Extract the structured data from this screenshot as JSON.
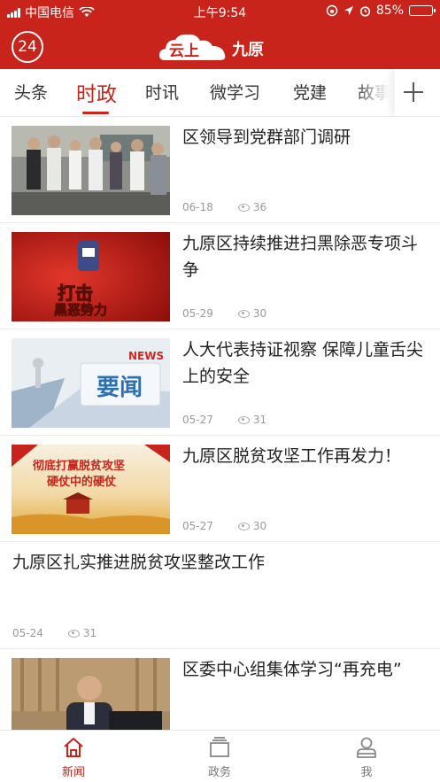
{
  "status_bar": {
    "carrier": "中国电信",
    "time": "上午9:54",
    "battery": "85%",
    "battery_level": 0.85
  },
  "header": {
    "badge": "24",
    "logo_left": "云上",
    "logo_right": "九原"
  },
  "tabs": [
    {
      "label": "头条",
      "active": false
    },
    {
      "label": "时政",
      "active": true
    },
    {
      "label": "时讯",
      "active": false
    },
    {
      "label": "微学习",
      "active": false
    },
    {
      "label": "党建",
      "active": false
    },
    {
      "label": "故事",
      "active": false
    }
  ],
  "news": [
    {
      "title": "区领导到党群部门调研",
      "date": "06-18",
      "views": "36",
      "thumb": "meeting-photo"
    },
    {
      "title": "九原区持续推进扫黑除恶专项斗争",
      "date": "05-29",
      "views": "30",
      "thumb": "crackdown-banner",
      "thumb_text": "打击黑恶势力"
    },
    {
      "title": "人大代表持证视察 保障儿童舌尖上的安全",
      "date": "05-27",
      "views": "31",
      "thumb": "news-banner",
      "thumb_text": "要闻",
      "thumb_tag": "NEWS"
    },
    {
      "title": "九原区脱贫攻坚工作再发力！",
      "date": "05-27",
      "views": "30",
      "thumb": "poverty-banner",
      "thumb_text": "彻底打赢脱贫攻坚硬仗中的硬仗"
    },
    {
      "title": "九原区扎实推进脱贫攻坚整改工作",
      "date": "05-24",
      "views": "31",
      "thumb": null
    },
    {
      "title": "区委中心组集体学习“再充电”",
      "date": "",
      "views": "",
      "thumb": "speaker-photo"
    }
  ],
  "bottom_nav": [
    {
      "label": "新闻",
      "icon": "home-icon",
      "active": true
    },
    {
      "label": "政务",
      "icon": "government-icon",
      "active": false
    },
    {
      "label": "我",
      "icon": "user-icon",
      "active": false
    }
  ],
  "colors": {
    "brand": "#c8241c"
  }
}
